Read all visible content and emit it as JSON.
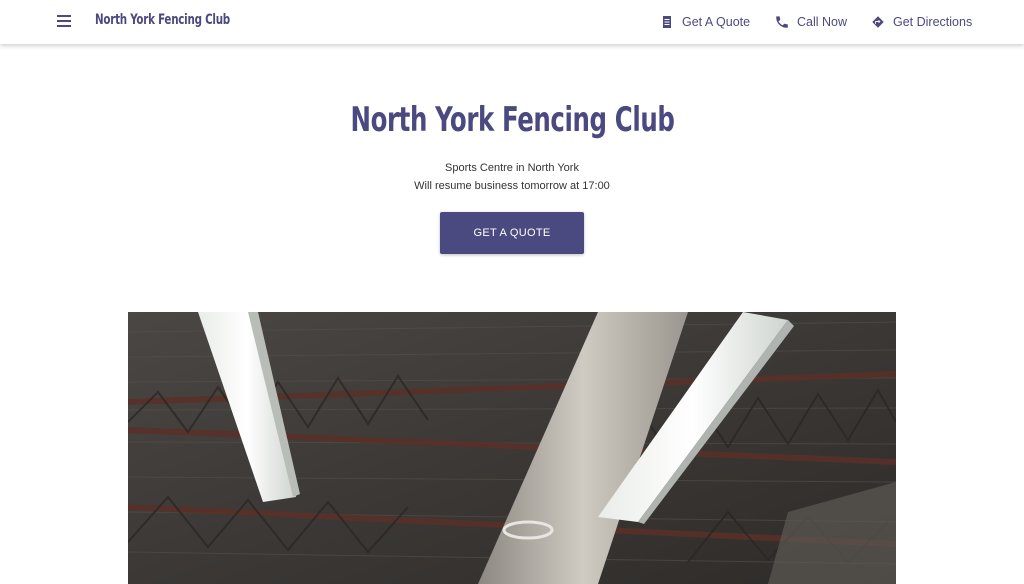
{
  "header": {
    "brand": "North York Fencing Club",
    "menu_icon": "hamburger-menu-icon",
    "links": [
      {
        "label": "Get A Quote",
        "icon": "document-icon"
      },
      {
        "label": "Call Now",
        "icon": "phone-icon"
      },
      {
        "label": "Get Directions",
        "icon": "directions-icon"
      }
    ]
  },
  "hero": {
    "title": "North York Fencing Club",
    "subtitle": "Sports Centre in North York",
    "status": "Will resume business tomorrow at 17:00",
    "cta_label": "GET A QUOTE"
  },
  "colors": {
    "brand": "#4b4a80",
    "background": "#ffffff"
  }
}
